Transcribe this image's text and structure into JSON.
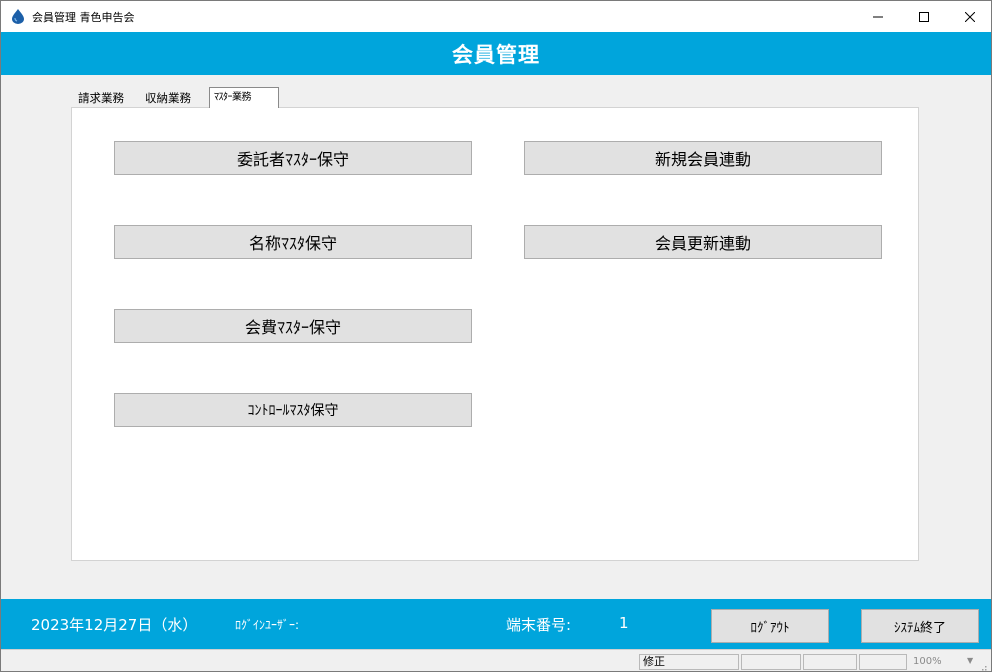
{
  "window": {
    "title": "会員管理 青色申告会",
    "icon": "drop-icon"
  },
  "header": {
    "title": "会員管理"
  },
  "tabs": [
    {
      "label": "請求業務",
      "selected": false
    },
    {
      "label": "収納業務",
      "selected": false
    },
    {
      "label": "ﾏｽﾀｰ業務",
      "selected": true
    }
  ],
  "buttons": {
    "consignor_master": "委託者ﾏｽﾀｰ保守",
    "name_master": "名称ﾏｽﾀ保守",
    "fee_master": "会費ﾏｽﾀｰ保守",
    "control_master": "ｺﾝﾄﾛｰﾙﾏｽﾀ保守",
    "new_member_link": "新規会員連動",
    "member_update_link": "会員更新連動"
  },
  "footer": {
    "date": "2023年12月27日（水）",
    "login_user_label": "ﾛｸﾞｲﾝﾕｰｻﾞｰ:",
    "terminal_label": "端末番号:",
    "terminal_value": "1",
    "logout_label": "ﾛｸﾞｱｳﾄ",
    "exit_label": "ｼｽﾃﾑ終了"
  },
  "statusbar": {
    "mode": "修正",
    "zoom": "100%"
  },
  "colors": {
    "accent": "#00a5dc",
    "button_bg": "#e1e1e1",
    "window_bg": "#f0f0f0"
  }
}
